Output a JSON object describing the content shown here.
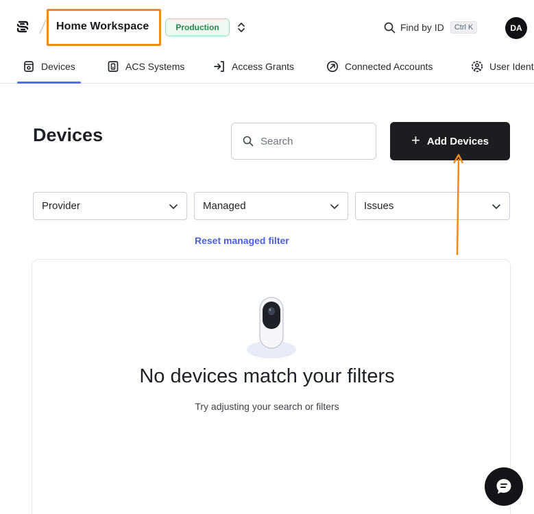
{
  "header": {
    "workspace_name": "Home Workspace",
    "environment_badge": "Production",
    "find_label": "Find by ID",
    "find_shortcut": "Ctrl K",
    "avatar_initials": "DA"
  },
  "tabs": [
    {
      "label": "Devices",
      "icon": "device-icon",
      "active": true
    },
    {
      "label": "ACS Systems",
      "icon": "acs-icon",
      "active": false
    },
    {
      "label": "Access Grants",
      "icon": "access-grant-icon",
      "active": false
    },
    {
      "label": "Connected Accounts",
      "icon": "connected-accounts-icon",
      "active": false
    },
    {
      "label": "User Identities",
      "icon": "user-identity-icon",
      "active": false
    }
  ],
  "page": {
    "title": "Devices",
    "search_placeholder": "Search",
    "add_button_label": "Add Devices"
  },
  "filters": [
    {
      "label": "Provider"
    },
    {
      "label": "Managed"
    },
    {
      "label": "Issues"
    }
  ],
  "reset_link": "Reset managed filter",
  "empty_state": {
    "title": "No devices match your filters",
    "subtitle": "Try adjusting your search or filters"
  },
  "colors": {
    "accent": "#4f6fe8",
    "annotation": "#f08a1c",
    "badge_green": "#1e8a4b",
    "primary_button": "#1b1d21"
  }
}
